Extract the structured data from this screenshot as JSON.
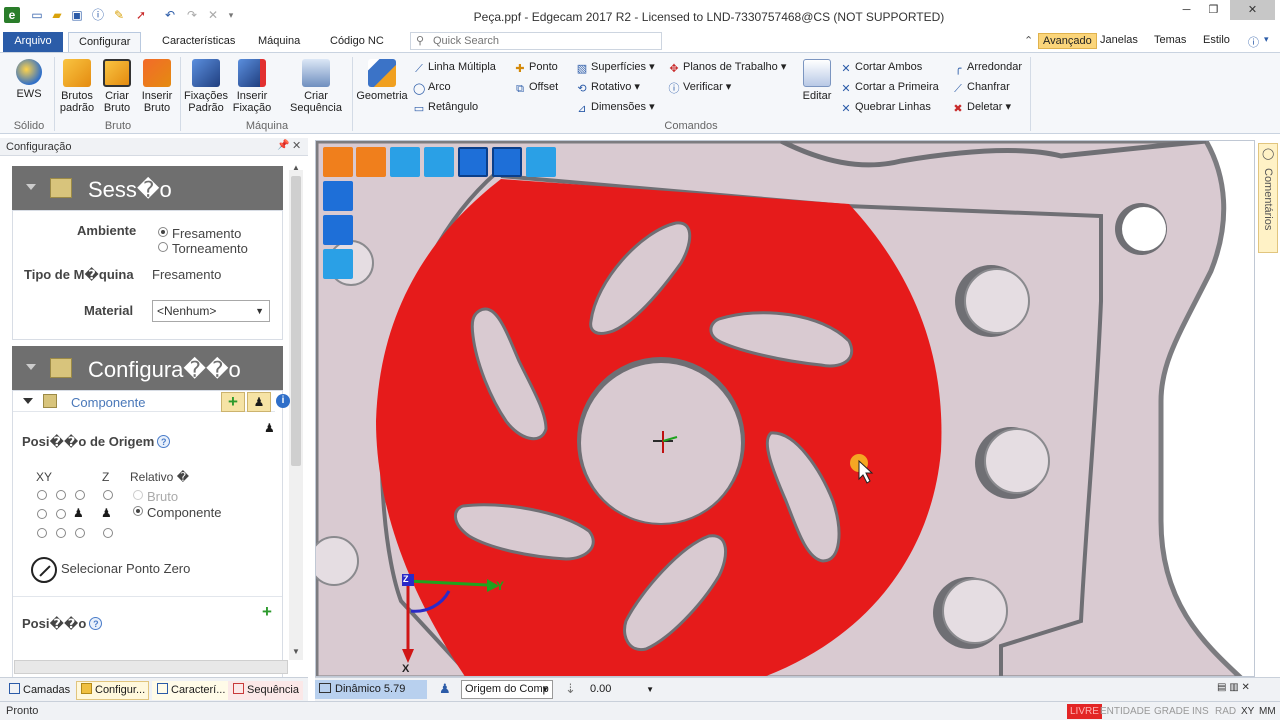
{
  "window": {
    "title": "Peça.ppf - Edgecam 2017 R2 - Licensed to LND-7330757468@CS (NOT SUPPORTED)",
    "app_logo": "e",
    "controls": [
      "─",
      "❐",
      "✕"
    ]
  },
  "quick_access_icons": [
    "new-icon",
    "open-icon",
    "save-icon",
    "info-icon",
    "wand-icon",
    "cursor-icon",
    "undo-icon",
    "redo-icon",
    "cancel-icon"
  ],
  "tabs": {
    "arquivo": "Arquivo",
    "items": [
      "Configurar",
      "Características",
      "Máquina",
      "Código NC"
    ],
    "active": "Configurar"
  },
  "search": {
    "placeholder": "Quick Search"
  },
  "right_menu": {
    "avancado": "Avançado",
    "janelas": "Janelas",
    "temas": "Temas",
    "estilo": "Estilo"
  },
  "ribbon": {
    "solido": {
      "ews": "EWS",
      "label": "Sólido"
    },
    "bruto": {
      "brutos_padrao": "Brutos padrão",
      "criar_bruto": "Criar Bruto",
      "inserir_bruto": "Inserir Bruto",
      "label": "Bruto"
    },
    "maquina": {
      "fixacoes_padrao": "Fixações Padrão",
      "inserir_fixacao": "Inserir Fixação",
      "criar_sequencia": "Criar Sequência",
      "label": "Máquina"
    },
    "comandos": {
      "geometria": "Geometria",
      "linha_multipla": "Linha Múltipla",
      "arco": "Arco",
      "retangulo": "Retângulo",
      "ponto": "Ponto",
      "offset": "Offset",
      "superficies": "Superfícies",
      "rotativo": "Rotativo",
      "dimensoes": "Dimensões",
      "planos_trabalho": "Planos de Trabalho",
      "verificar": "Verificar",
      "editar": "Editar",
      "cortar_ambos": "Cortar Ambos",
      "cortar_primeira": "Cortar a Primeira",
      "quebrar_linhas": "Quebrar Linhas",
      "arredondar": "Arredondar",
      "chanfrar": "Chanfrar",
      "deletar": "Deletar",
      "label": "Comandos"
    }
  },
  "panel": {
    "title": "Configuração",
    "sessao": {
      "heading": "Sess�o",
      "ambiente_label": "Ambiente",
      "ambiente_options": [
        "Fresamento",
        "Torneamento"
      ],
      "ambiente_selected": "Fresamento",
      "tipo_maquina_label": "Tipo de M�quina",
      "tipo_maquina_value": "Fresamento",
      "material_label": "Material",
      "material_value": "<Nenhum>"
    },
    "configuracao": {
      "heading": "Configura��o",
      "componente": "Componente",
      "posicao_origem_label": "Posi��o de Origem",
      "xy_label": "XY",
      "z_label": "Z",
      "relativo_label": "Relativo �",
      "relativo_options": [
        "Bruto",
        "Componente"
      ],
      "relativo_selected": "Componente",
      "selecionar_ponto_zero": "Selecionar Ponto Zero",
      "posicao_label": "Posi��o"
    }
  },
  "bottom_tabs": [
    "Camadas",
    "Configur...",
    "Caracterí...",
    "Sequência"
  ],
  "viewport": {
    "comments_tab": "Comentários",
    "axes": {
      "x": "X",
      "y": "Y",
      "z": "Z"
    },
    "view_icons": [
      "iso-view-icon",
      "machine-view-icon",
      "fixture-view-icon",
      "tool-view-icon",
      "zoom-icon",
      "list-view-icon",
      "grid-view-icon",
      "top-view-icon",
      "front-view-icon",
      "side-view-icon"
    ]
  },
  "view_status": {
    "dynamic": "Dinâmico 5.79",
    "origin": "Origem do Comp",
    "zoom_value": "0.00"
  },
  "status": {
    "text": "Pronto",
    "flags": [
      "LIVRE",
      "ENTIDADE",
      "GRADE",
      "INS",
      "RAD",
      "XY",
      "MM"
    ]
  },
  "colors": {
    "accent": "#2b5ca8",
    "part_red": "#e61b1b",
    "part_pink": "#d8c7cf",
    "avancado_bg": "#fbd57a",
    "section_header": "#6f6f6f",
    "livre_flag": "#e32525"
  }
}
